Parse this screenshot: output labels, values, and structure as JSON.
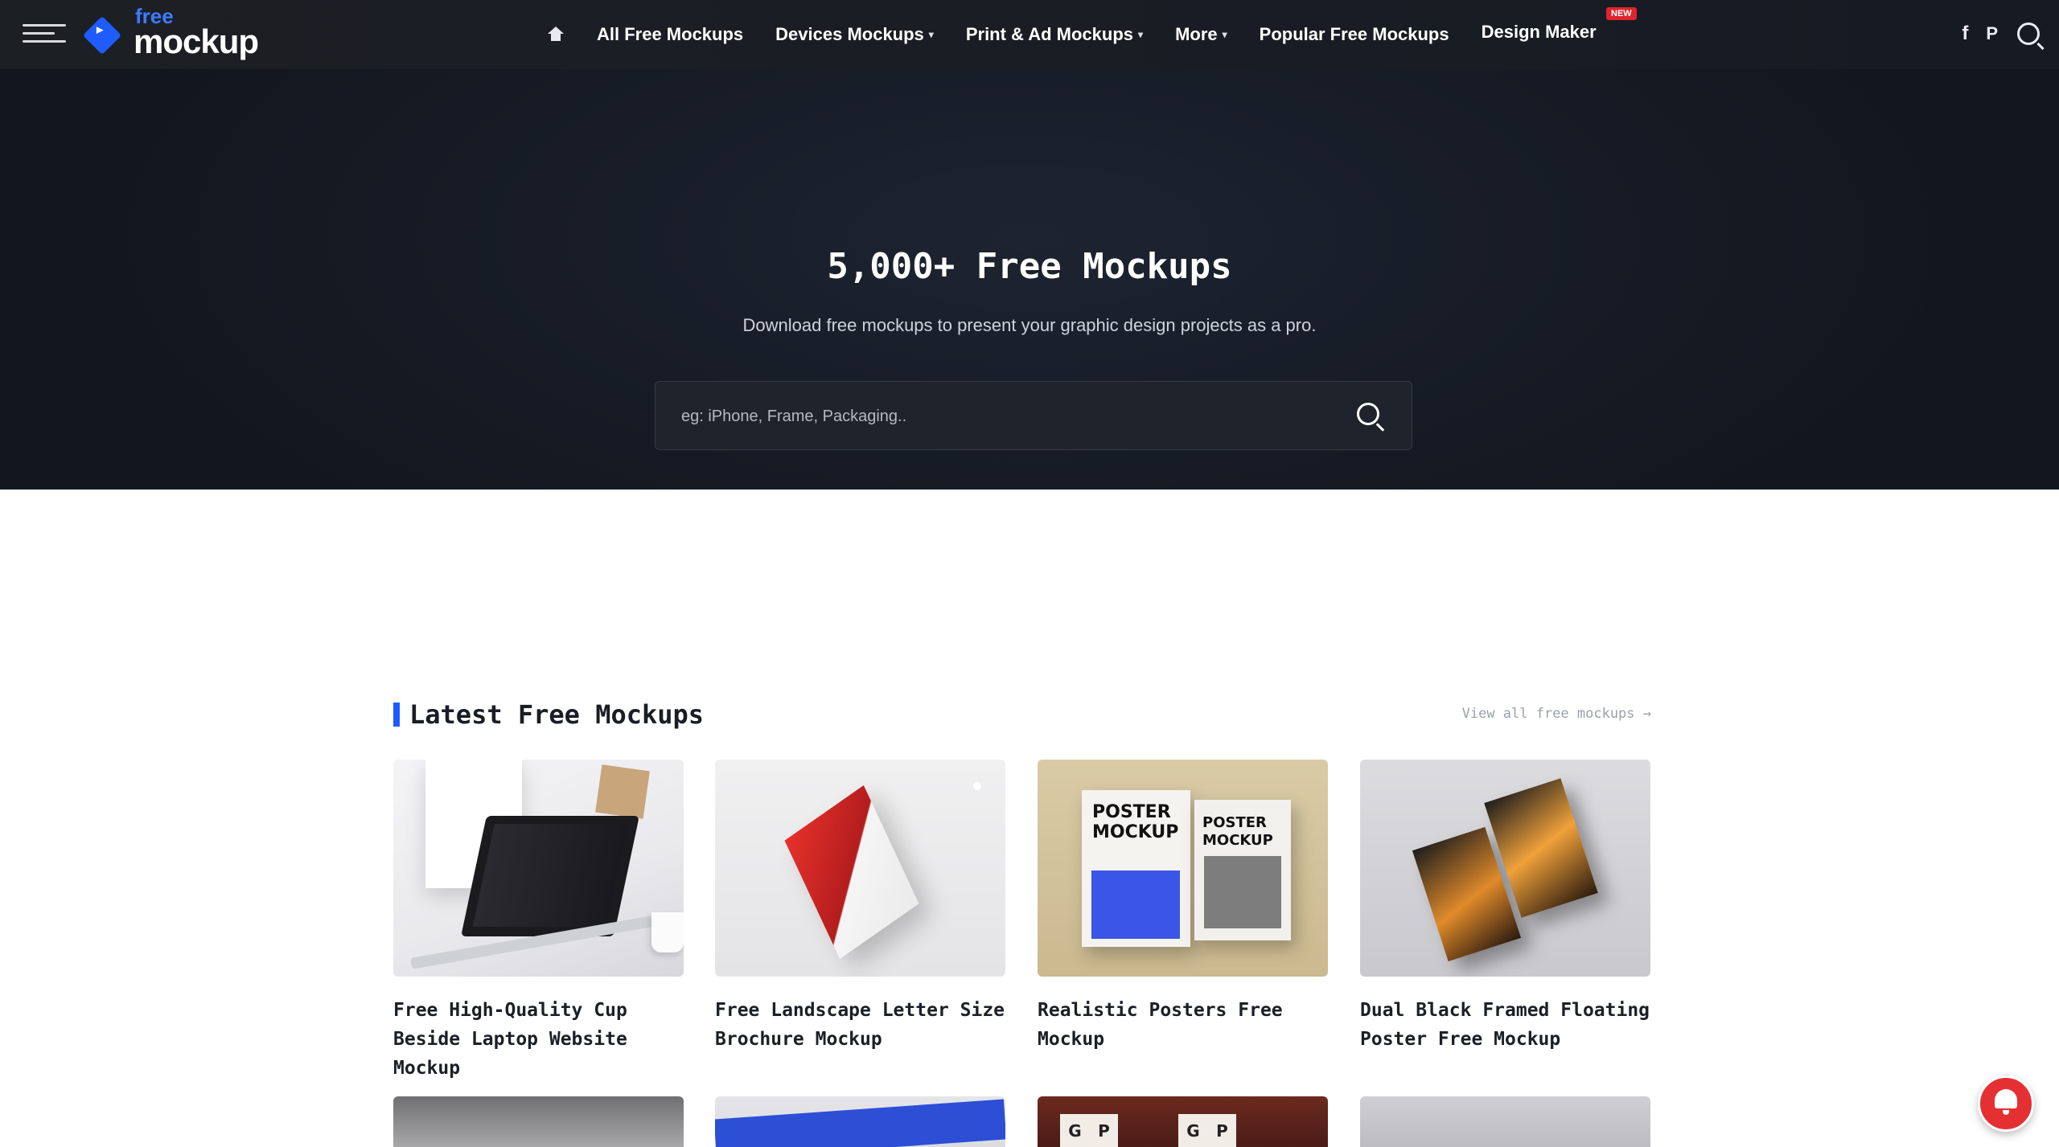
{
  "topbar": {
    "brand_free": "free",
    "brand_mockup": "mockup",
    "nav": [
      {
        "label": "All Free Mockups"
      },
      {
        "label": "Devices Mockups"
      },
      {
        "label": "Print & Ad Mockups"
      },
      {
        "label": "More"
      },
      {
        "label": "Popular Free Mockups"
      },
      {
        "label": "Design Maker",
        "badge": "NEW"
      }
    ],
    "social": {
      "facebook": "f",
      "pinterest": "P"
    }
  },
  "hero": {
    "title": "5,000+ Free Mockups",
    "subtitle": "Download free mockups to present your graphic design projects as a pro.",
    "search_placeholder": "eg: iPhone, Frame, Packaging.."
  },
  "section": {
    "title": "Latest Free Mockups",
    "view_all": "View all free mockups →"
  },
  "cards": [
    {
      "title": "Free High-Quality Cup Beside Laptop Website Mockup"
    },
    {
      "title": "Free Landscape Letter Size Brochure Mockup"
    },
    {
      "title": "Realistic Posters Free Mockup"
    },
    {
      "title": "Dual Black Framed Floating Poster Free Mockup"
    }
  ],
  "thumb3_text": {
    "line1": "POSTER",
    "line2": "MOCKUP"
  },
  "thumb_row2_tiles": [
    "G",
    "P",
    "G",
    "P"
  ],
  "colors": {
    "accent": "#1f5cff",
    "badge": "#e0242e",
    "bell": "#e53033"
  },
  "icons": [
    "menu-icon",
    "home-icon",
    "facebook-icon",
    "pinterest-icon",
    "search-icon",
    "bell-icon"
  ]
}
